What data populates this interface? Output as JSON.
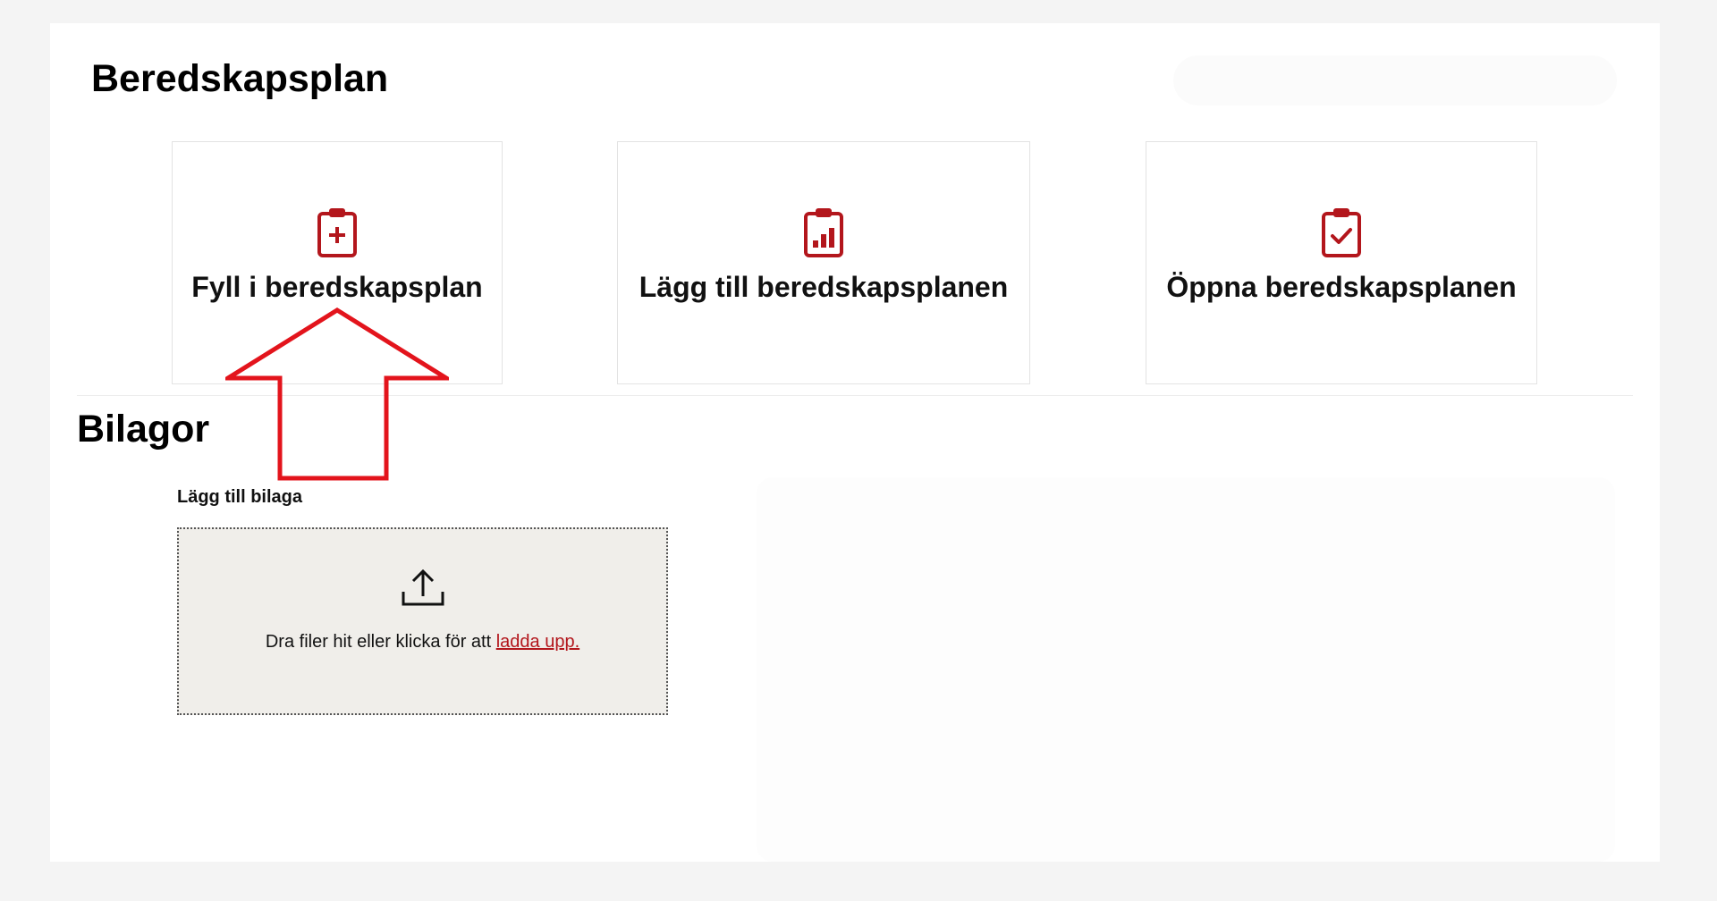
{
  "preparedness": {
    "title": "Beredskapsplan",
    "cards": [
      {
        "label": "Fyll i beredskapsplan",
        "icon": "clipboard-plus-icon"
      },
      {
        "label": "Lägg till beredskapsplanen",
        "icon": "clipboard-chart-icon"
      },
      {
        "label": "Öppna beredskapsplanen",
        "icon": "clipboard-check-icon"
      }
    ]
  },
  "attachments": {
    "title": "Bilagor",
    "upload_label": "Lägg till bilaga",
    "drop_text": "Dra filer hit eller klicka för att ",
    "drop_link": "ladda upp.",
    "icon": "upload-icon"
  },
  "annotation": {
    "icon": "red-up-arrow"
  },
  "colors": {
    "accent": "#b3161c",
    "annotation": "#e3141c",
    "dropzone_bg": "#f0eeea"
  }
}
